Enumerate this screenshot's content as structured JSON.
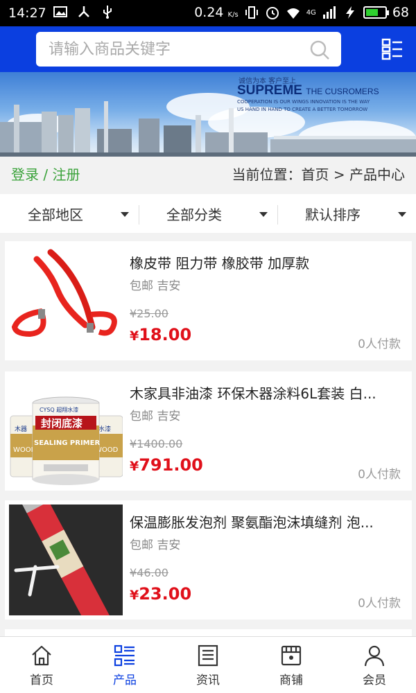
{
  "status_bar": {
    "time": "14:27",
    "speed": "0.24",
    "speed_unit": "K/s",
    "network": "4G",
    "battery": "68",
    "battery_level": 0.68
  },
  "header": {
    "search_placeholder": "请输入商品关键字",
    "search_icon": "search-icon",
    "menu_icon": "list-menu-icon"
  },
  "banner": {
    "tagline": "诚信为本 客户至上",
    "title_big": "SUPREME",
    "title_small": "THE CUSROMERS",
    "sub_en": "COOPERATION IS OUR WINGS INNOVATION IS THE WAY",
    "sub_en2": "US HAND IN HAND TO CREATE A BETTER TOMORROW"
  },
  "breadcrumb": {
    "login": "登录 / 注册",
    "location": "当前位置：首页 > 产品中心"
  },
  "filters": [
    {
      "label": "全部地区"
    },
    {
      "label": "全部分类"
    },
    {
      "label": "默认排序"
    }
  ],
  "products": [
    {
      "title": "橡皮带 阻力带 橡胶带 加厚款",
      "meta": "包邮 吉安",
      "old_price": "¥25.00",
      "price_symbol": "¥",
      "price": "18.00",
      "sold": "0人付款"
    },
    {
      "title": "木家具非油漆 环保木器涂料6L套装 白...",
      "meta": "包邮 吉安",
      "old_price": "¥1400.00",
      "price_symbol": "¥",
      "price": "791.00",
      "sold": "0人付款",
      "img_brand": "CYSQ 超翔水漆",
      "img_label": "封闭底漆",
      "img_en": "SEALING PRIMER",
      "img_side_label": "器水漆",
      "img_side_left": "木器",
      "img_wood": "WOOD"
    },
    {
      "title": "保温膨胀发泡剂 聚氨酯泡沫填缝剂 泡...",
      "meta": "包邮 吉安",
      "old_price": "¥46.00",
      "price_symbol": "¥",
      "price": "23.00",
      "sold": "0人付款"
    }
  ],
  "bottom_nav": [
    {
      "label": "首页",
      "icon": "home-icon",
      "active": false
    },
    {
      "label": "产品",
      "icon": "product-list-icon",
      "active": true
    },
    {
      "label": "资讯",
      "icon": "news-icon",
      "active": false
    },
    {
      "label": "商铺",
      "icon": "shop-icon",
      "active": false
    },
    {
      "label": "会员",
      "icon": "member-icon",
      "active": false
    }
  ],
  "colors": {
    "header_blue": "#0b3fe0",
    "price_red": "#e0101a",
    "login_green": "#3aa23a"
  }
}
